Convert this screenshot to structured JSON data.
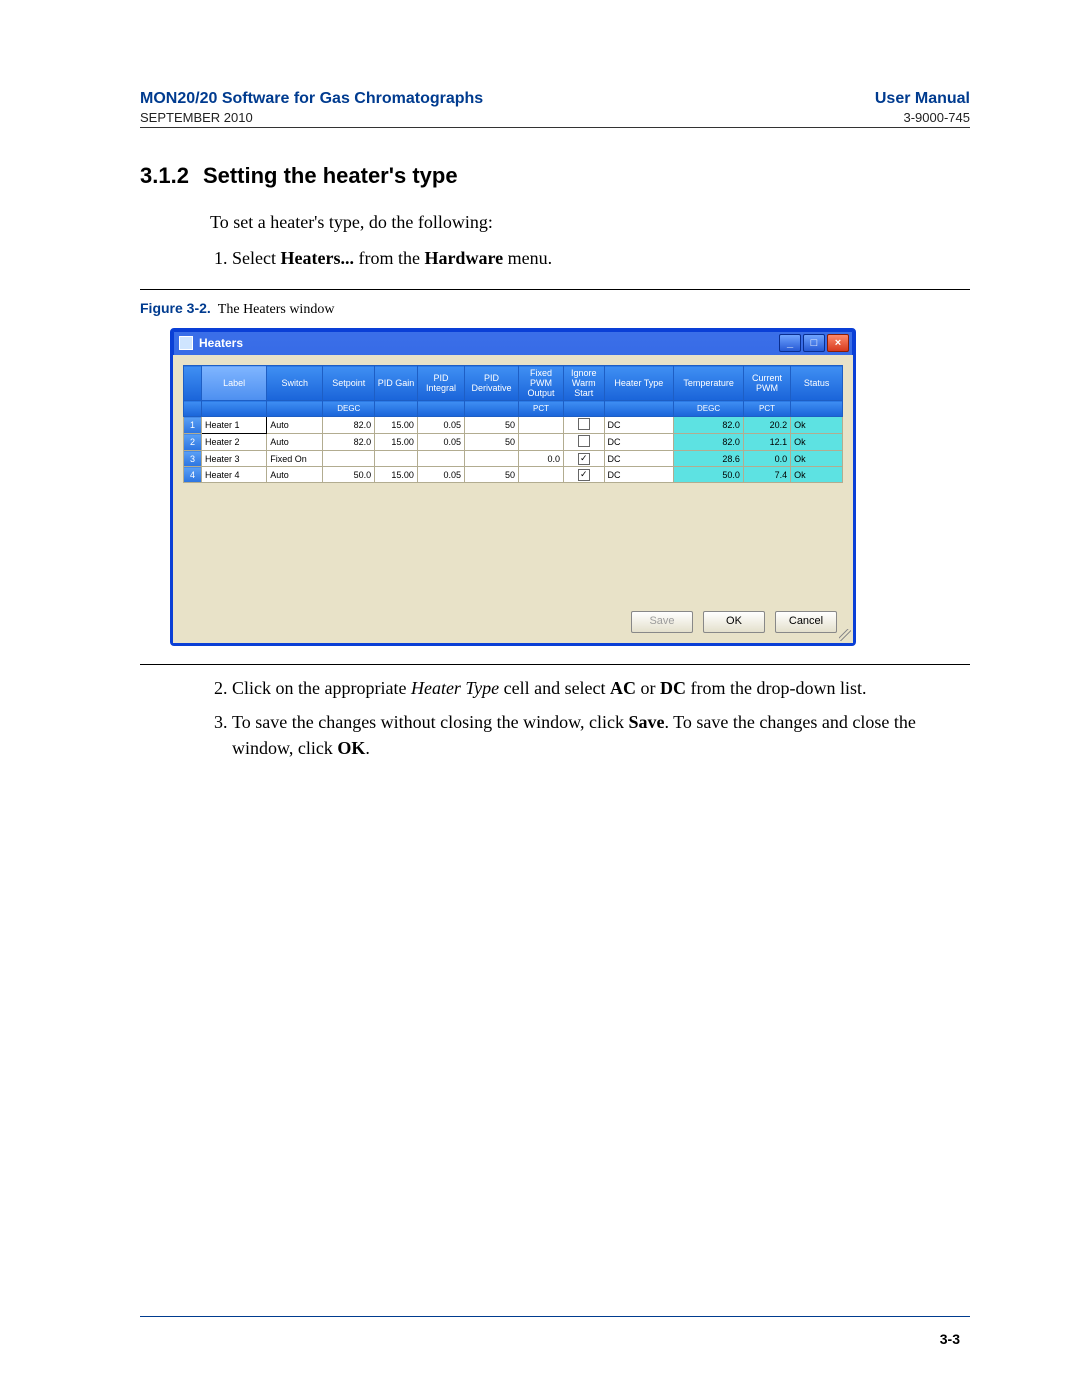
{
  "header": {
    "title_left": "MON20/20 Software for Gas Chromatographs",
    "title_right": "User Manual",
    "sub_left": "SEPTEMBER 2010",
    "sub_right": "3-9000-745"
  },
  "section": {
    "number": "3.1.2",
    "title": "Setting the heater's type"
  },
  "intro": "To set a heater's type, do the following:",
  "step1_pre": "Select ",
  "step1_b1": "Heaters...",
  "step1_mid": " from the ",
  "step1_b2": "Hardware",
  "step1_post": " menu.",
  "figure": {
    "label": "Figure 3-2.",
    "caption": "The Heaters window"
  },
  "window": {
    "title": "Heaters",
    "columns": [
      "",
      "Label",
      "Switch",
      "Setpoint",
      "PID Gain",
      "PID Integral",
      "PID Derivative",
      "Fixed PWM Output",
      "Ignore Warm Start",
      "Heater Type",
      "Temperature",
      "Current PWM",
      "Status"
    ],
    "units": [
      "",
      "",
      "",
      "DEGC",
      "",
      "",
      "",
      "PCT",
      "",
      "",
      "DEGC",
      "PCT",
      ""
    ],
    "rows": [
      {
        "n": "1",
        "label": "Heater 1",
        "switch": "Auto",
        "setpoint": "82.0",
        "gain": "15.00",
        "integral": "0.05",
        "deriv": "50",
        "pwm": "",
        "ignore": false,
        "type": "DC",
        "temp": "82.0",
        "cpwm": "20.2",
        "status": "Ok"
      },
      {
        "n": "2",
        "label": "Heater 2",
        "switch": "Auto",
        "setpoint": "82.0",
        "gain": "15.00",
        "integral": "0.05",
        "deriv": "50",
        "pwm": "",
        "ignore": false,
        "type": "DC",
        "temp": "82.0",
        "cpwm": "12.1",
        "status": "Ok"
      },
      {
        "n": "3",
        "label": "Heater 3",
        "switch": "Fixed On",
        "setpoint": "",
        "gain": "",
        "integral": "",
        "deriv": "",
        "pwm": "0.0",
        "ignore": true,
        "type": "DC",
        "temp": "28.6",
        "cpwm": "0.0",
        "status": "Ok"
      },
      {
        "n": "4",
        "label": "Heater 4",
        "switch": "Auto",
        "setpoint": "50.0",
        "gain": "15.00",
        "integral": "0.05",
        "deriv": "50",
        "pwm": "",
        "ignore": true,
        "type": "DC",
        "temp": "50.0",
        "cpwm": "7.4",
        "status": "Ok"
      }
    ],
    "buttons": {
      "save": "Save",
      "ok": "OK",
      "cancel": "Cancel"
    }
  },
  "step2_a": "Click on the appropriate ",
  "step2_i": "Heater Type",
  "step2_b": " cell and select ",
  "step2_bold1": "AC",
  "step2_c": " or ",
  "step2_bold2": "DC",
  "step2_d": " from the drop-down list.",
  "step3_a": "To save the changes without closing the window, click ",
  "step3_b1": "Save",
  "step3_b": ". To save the changes and close the window, click ",
  "step3_b2": "OK",
  "step3_c": ".",
  "page_number": "3-3"
}
